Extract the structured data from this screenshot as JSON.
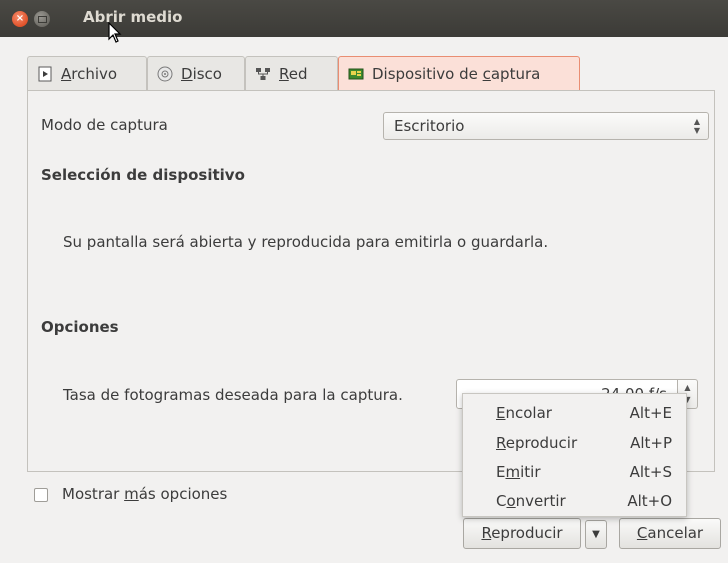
{
  "window": {
    "title": "Abrir medio"
  },
  "tabs": [
    {
      "pre": "",
      "u": "A",
      "post": "rchivo",
      "icon": "file-play-icon"
    },
    {
      "pre": "",
      "u": "D",
      "post": "isco",
      "icon": "disc-icon"
    },
    {
      "pre": "",
      "u": "R",
      "post": "ed",
      "icon": "network-icon"
    },
    {
      "pre": "Dispositivo de ",
      "u": "c",
      "post": "aptura",
      "icon": "capture-card-icon",
      "active": true
    }
  ],
  "capture": {
    "mode_label": "Modo de captura",
    "mode_value": "Escritorio",
    "device_header": "Selección de dispositivo",
    "description": "Su pantalla será abierta y reproducida para emitirla o guardarla.",
    "options_header": "Opciones",
    "fps_label": "Tasa de fotogramas deseada para la captura.",
    "fps_value": "24.00 f/s"
  },
  "more_options": {
    "pre": "Mostrar ",
    "u": "m",
    "post": "ás opciones",
    "checked": false
  },
  "menu": [
    {
      "pre": "",
      "u": "E",
      "post": "ncolar",
      "shortcut": "Alt+E"
    },
    {
      "pre": "",
      "u": "R",
      "post": "eproducir",
      "shortcut": "Alt+P"
    },
    {
      "pre": "E",
      "u": "m",
      "post": "itir",
      "shortcut": "Alt+S"
    },
    {
      "pre": "C",
      "u": "o",
      "post": "nvertir",
      "shortcut": "Alt+O"
    }
  ],
  "buttons": {
    "play": {
      "pre": "",
      "u": "R",
      "post": "eproducir"
    },
    "cancel": {
      "pre": "",
      "u": "C",
      "post": "ancelar"
    }
  },
  "colors": {
    "titlebar": "#3c3b37",
    "accent_tab": "#fbe0d8",
    "close_button": "#e0522a"
  }
}
